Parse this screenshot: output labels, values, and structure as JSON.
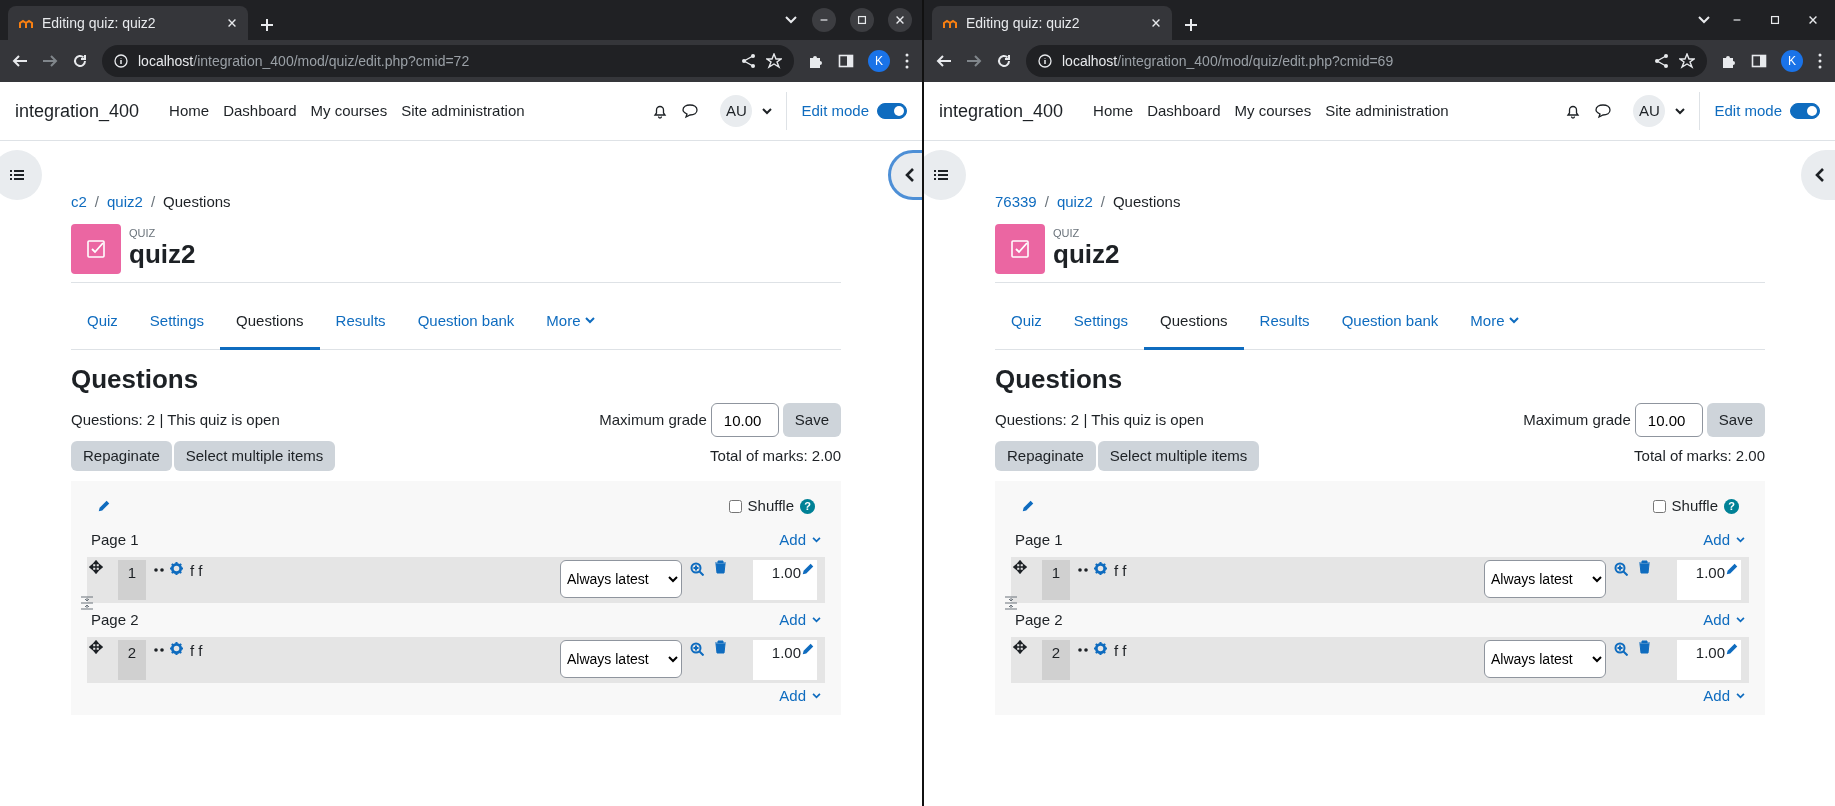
{
  "windows": [
    {
      "focused": true,
      "breadcrumb_separator": "/",
      "help_mark": "?",
      "tab_title": "Editing quiz: quiz2",
      "url_host": "localhost",
      "url_path": "/integration_400/mod/quiz/edit.php?cmid=72",
      "profile_initial": "K",
      "site_name": "integration_400",
      "nav_items": [
        "Home",
        "Dashboard",
        "My courses",
        "Site administration"
      ],
      "avatar": "AU",
      "edit_mode_label": "Edit mode",
      "edit_mode_on": true,
      "drawer_focused": true,
      "breadcrumb": [
        {
          "label": "c2",
          "link": true
        },
        {
          "label": "quiz2",
          "link": true
        },
        {
          "label": "Questions",
          "link": false
        }
      ],
      "activity_kind": "QUIZ",
      "title": "quiz2",
      "tabs": [
        {
          "label": "Quiz",
          "selected": false
        },
        {
          "label": "Settings",
          "selected": false
        },
        {
          "label": "Questions",
          "selected": true
        },
        {
          "label": "Results",
          "selected": false
        },
        {
          "label": "Question bank",
          "selected": false
        },
        {
          "label": "More",
          "selected": false
        }
      ],
      "heading": "Questions",
      "summary": "Questions: 2 | This quiz is open",
      "max_grade_label": "Maximum grade",
      "max_grade_value": "10.00",
      "save_label": "Save",
      "buttons": [
        "Repaginate",
        "Select multiple items"
      ],
      "total_marks": "Total of marks: 2.00",
      "shuffle_label": "Shuffle",
      "shuffle_checked": false,
      "pages": [
        {
          "title": "Page 1",
          "add_label": "Add",
          "questions": [
            {
              "number": "1",
              "name": "f f",
              "version": "Always latest",
              "mark": "1.00"
            }
          ]
        },
        {
          "title": "Page 2",
          "add_label": "Add",
          "questions": [
            {
              "number": "2",
              "name": "f f",
              "version": "Always latest",
              "mark": "1.00"
            }
          ]
        }
      ],
      "final_add_label": "Add"
    },
    {
      "focused": false,
      "breadcrumb_separator": "/",
      "help_mark": "?",
      "tab_title": "Editing quiz: quiz2",
      "url_host": "localhost",
      "url_path": "/integration_400/mod/quiz/edit.php?cmid=69",
      "profile_initial": "K",
      "site_name": "integration_400",
      "nav_items": [
        "Home",
        "Dashboard",
        "My courses",
        "Site administration"
      ],
      "avatar": "AU",
      "edit_mode_label": "Edit mode",
      "edit_mode_on": true,
      "drawer_focused": false,
      "breadcrumb": [
        {
          "label": "76339",
          "link": true
        },
        {
          "label": "quiz2",
          "link": true
        },
        {
          "label": "Questions",
          "link": false
        }
      ],
      "activity_kind": "QUIZ",
      "title": "quiz2",
      "tabs": [
        {
          "label": "Quiz",
          "selected": false
        },
        {
          "label": "Settings",
          "selected": false
        },
        {
          "label": "Questions",
          "selected": true
        },
        {
          "label": "Results",
          "selected": false
        },
        {
          "label": "Question bank",
          "selected": false
        },
        {
          "label": "More",
          "selected": false
        }
      ],
      "heading": "Questions",
      "summary": "Questions: 2 | This quiz is open",
      "max_grade_label": "Maximum grade",
      "max_grade_value": "10.00",
      "save_label": "Save",
      "buttons": [
        "Repaginate",
        "Select multiple items"
      ],
      "total_marks": "Total of marks: 2.00",
      "shuffle_label": "Shuffle",
      "shuffle_checked": false,
      "pages": [
        {
          "title": "Page 1",
          "add_label": "Add",
          "questions": [
            {
              "number": "1",
              "name": "f f",
              "version": "Always latest",
              "mark": "1.00"
            }
          ]
        },
        {
          "title": "Page 2",
          "add_label": "Add",
          "questions": [
            {
              "number": "2",
              "name": "f f",
              "version": "Always latest",
              "mark": "1.00"
            }
          ]
        }
      ],
      "final_add_label": "Add"
    }
  ]
}
